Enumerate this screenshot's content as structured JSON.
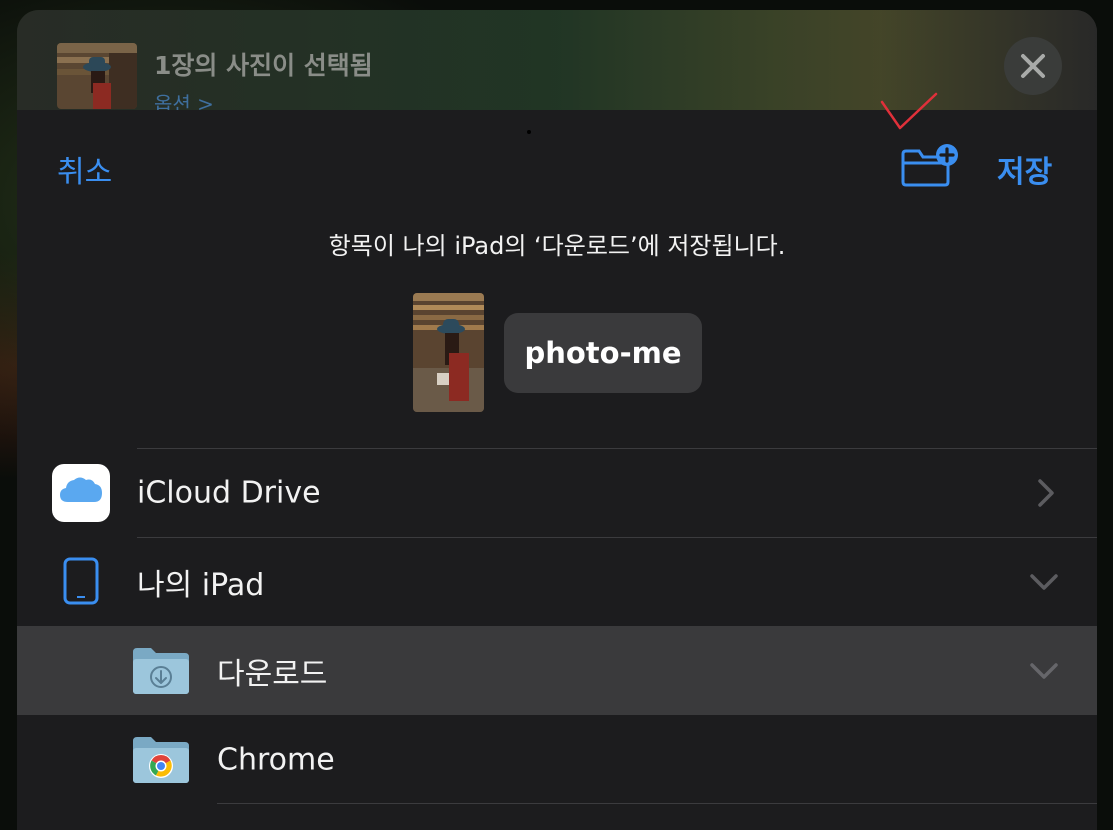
{
  "share_header": {
    "title": "1장의 사진이 선택됨",
    "options_label": "옵션 >"
  },
  "nav": {
    "cancel_label": "취소",
    "save_label": "저장"
  },
  "save_message": "항목이 나의 iPad의 ‘다운로드’에 저장됩니다.",
  "file": {
    "name": "photo-me"
  },
  "locations": [
    {
      "label": "iCloud Drive",
      "icon": "icloud-icon",
      "accessory": "chevron-right"
    },
    {
      "label": "나의 iPad",
      "icon": "ipad-icon",
      "accessory": "chevron-down"
    },
    {
      "label": "다운로드",
      "icon": "downloads-folder-icon",
      "accessory": "chevron-down",
      "selected": true
    },
    {
      "label": "Chrome",
      "icon": "chrome-folder-icon"
    }
  ],
  "colors": {
    "accent": "#3a8ef0",
    "sheet_background": "#1c1c1e",
    "selected_row": "#3a3a3c",
    "annotation_check": "#e0303a"
  }
}
